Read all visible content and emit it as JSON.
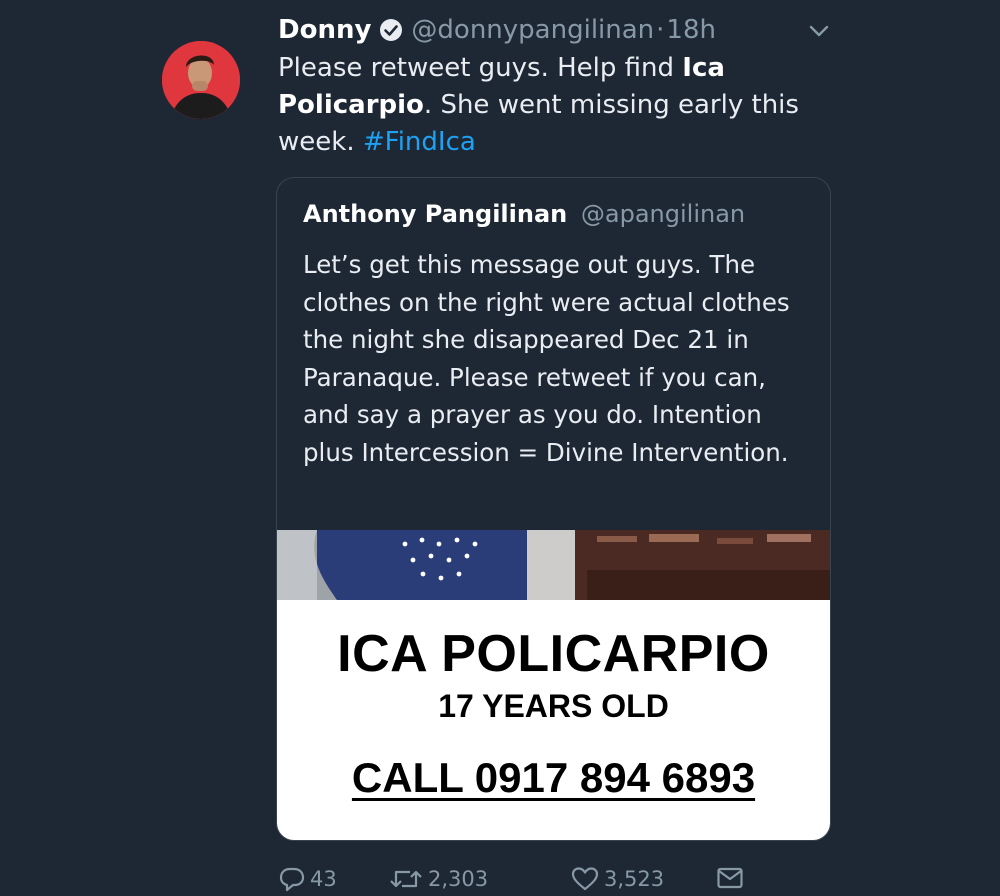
{
  "tweet": {
    "display_name": "Donny",
    "handle": "@donnypangilinan",
    "separator": "·",
    "time": "18h",
    "text_part1": "Please retweet guys. Help find ",
    "text_bold": "Ica Policarpio",
    "text_part2": ". She went missing early this week. ",
    "hashtag": "#FindIca"
  },
  "quoted_tweet": {
    "display_name": "Anthony Pangilinan",
    "handle": "@apangilinan",
    "text": "Let’s get this message out guys. The clothes on the right were actual clothes the night she disappeared Dec 21 in Paranaque. Please retweet if you can, and say a prayer as you do. Intention plus Intercession = Divine Intervention.",
    "poster": {
      "name": "ICA POLICARPIO",
      "age": "17 YEARS OLD",
      "call": "CALL 0917 894 6893"
    }
  },
  "actions": {
    "replies": "43",
    "retweets": "2,303",
    "likes": "3,523"
  },
  "colors": {
    "background": "#1e2835",
    "hashtag": "#1da1f2",
    "secondary_text": "#8899a6",
    "card_border": "#38444d",
    "avatar_bg": "#e0373f"
  },
  "icons": [
    "verified-icon",
    "chevron-down-icon",
    "reply-icon",
    "retweet-icon",
    "heart-icon",
    "envelope-icon"
  ]
}
